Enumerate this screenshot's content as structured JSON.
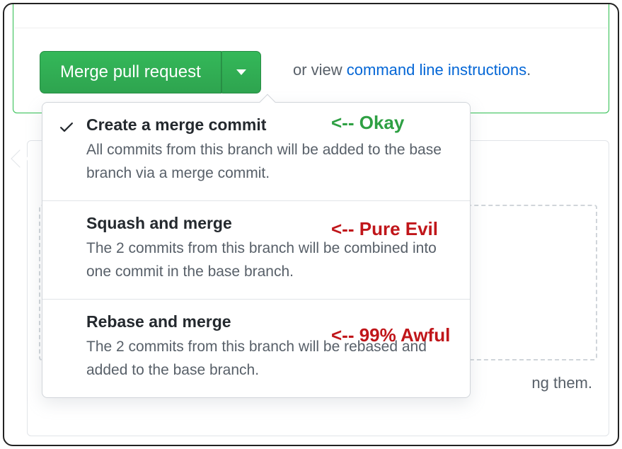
{
  "merge_button": {
    "label": "Merge pull request"
  },
  "or_view": {
    "prefix": "or view ",
    "link": "command line instructions",
    "suffix": "."
  },
  "dropdown": {
    "items": [
      {
        "title": "Create a merge commit",
        "desc": "All commits from this branch will be added to the base branch via a merge commit.",
        "selected": true
      },
      {
        "title": "Squash and merge",
        "desc": "The 2 commits from this branch will be combined into one commit in the base branch.",
        "selected": false
      },
      {
        "title": "Rebase and merge",
        "desc": "The 2 commits from this branch will be rebased and added to the base branch.",
        "selected": false
      }
    ]
  },
  "annotations": {
    "okay": "<-- Okay",
    "evil": "<-- Pure Evil",
    "awful": "<-- 99% Awful"
  },
  "background_hint": "ng them."
}
